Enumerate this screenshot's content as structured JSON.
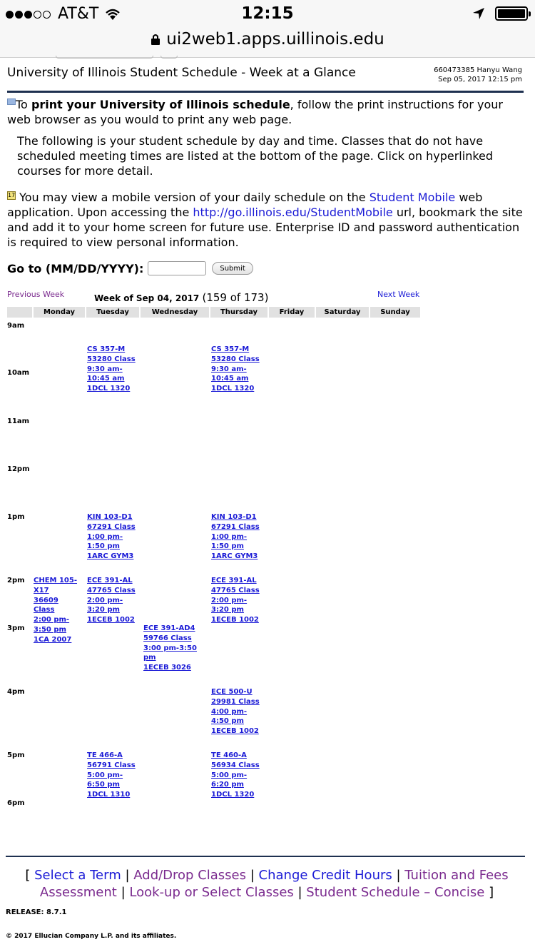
{
  "status": {
    "carrier": "AT&T",
    "time": "12:15"
  },
  "browser": {
    "url": "ui2web1.apps.uillinois.edu"
  },
  "header": {
    "title": "University of Illinois Student Schedule - Week at a Glance",
    "user": "660473385 Hanyu Wang",
    "datetime": "Sep 05, 2017 12:15 pm"
  },
  "intro": {
    "p1_pre": "To ",
    "p1_bold": "print your University of Illinois schedule",
    "p1_post": ", follow the print instructions for your web browser as you would to print any web page.",
    "p2": "The following is your student schedule by day and time. Classes that do not have scheduled meeting times are listed at the bottom of the page. Click on hyperlinked courses for more detail.",
    "p3_a": "You may view a mobile version of your daily schedule on the ",
    "p3_link1": "Student Mobile",
    "p3_b": " web application. Upon accessing the ",
    "p3_link2": "http://go.illinois.edu/StudentMobile",
    "p3_c": " url, bookmark the site and add it to your home screen for future use. Enterprise ID and password authentication is required to view personal information."
  },
  "goto": {
    "label": "Go to (MM/DD/YYYY):",
    "value": "",
    "submit": "Submit"
  },
  "week": {
    "prev": "Previous Week",
    "next": "Next Week",
    "title": "Week of Sep 04, 2017",
    "count": "(159 of 173)",
    "days": [
      "Monday",
      "Tuesday",
      "Wednesday",
      "Thursday",
      "Friday",
      "Saturday",
      "Sunday"
    ],
    "hours": [
      "9am",
      "10am",
      "11am",
      "12pm",
      "1pm",
      "2pm",
      "3pm",
      "4pm",
      "5pm",
      "6pm"
    ]
  },
  "events": [
    {
      "lines": [
        "CS 357-M",
        "53280 Class",
        "9:30 am-",
        "10:45 am",
        "1DCL 1320"
      ]
    },
    {
      "lines": [
        "CS 357-M",
        "53280 Class",
        "9:30 am-",
        "10:45 am",
        "1DCL 1320"
      ]
    },
    {
      "lines": [
        "KIN 103-D1",
        "67291 Class",
        "1:00 pm-",
        "1:50 pm",
        "1ARC GYM3"
      ]
    },
    {
      "lines": [
        "KIN 103-D1",
        "67291 Class",
        "1:00 pm-",
        "1:50 pm",
        "1ARC GYM3"
      ]
    },
    {
      "lines": [
        "CHEM 105-",
        "X17",
        "36609",
        "Class",
        "2:00 pm-",
        "3:50 pm",
        "1CA 2007"
      ]
    },
    {
      "lines": [
        "ECE 391-AL",
        "47765 Class",
        "2:00 pm-",
        "3:20 pm",
        "1ECEB 1002"
      ]
    },
    {
      "lines": [
        "ECE 391-AL",
        "47765 Class",
        "2:00 pm-",
        "3:20 pm",
        "1ECEB 1002"
      ]
    },
    {
      "lines": [
        "ECE 391-AD4",
        "59766 Class",
        "3:00 pm-3:50",
        "pm",
        "1ECEB 3026"
      ]
    },
    {
      "lines": [
        "ECE 500-U",
        "29981 Class",
        "4:00 pm-",
        "4:50 pm",
        "1ECEB 1002"
      ]
    },
    {
      "lines": [
        "TE 466-A",
        "56791 Class",
        "5:00 pm-",
        "6:50 pm",
        "1DCL 1310"
      ]
    },
    {
      "lines": [
        "TE 460-A",
        "56934 Class",
        "5:00 pm-",
        "6:20 pm",
        "1DCL 1320"
      ]
    }
  ],
  "footer": {
    "links": [
      "Select a Term",
      "Add/Drop Classes",
      "Change Credit Hours",
      "Tuition and Fees Assessment",
      "Look-up or Select Classes",
      "Student Schedule – Concise"
    ],
    "release": "RELEASE: 8.7.1",
    "copyright": "© 2017 Ellucian Company L.P. and its affiliates."
  }
}
